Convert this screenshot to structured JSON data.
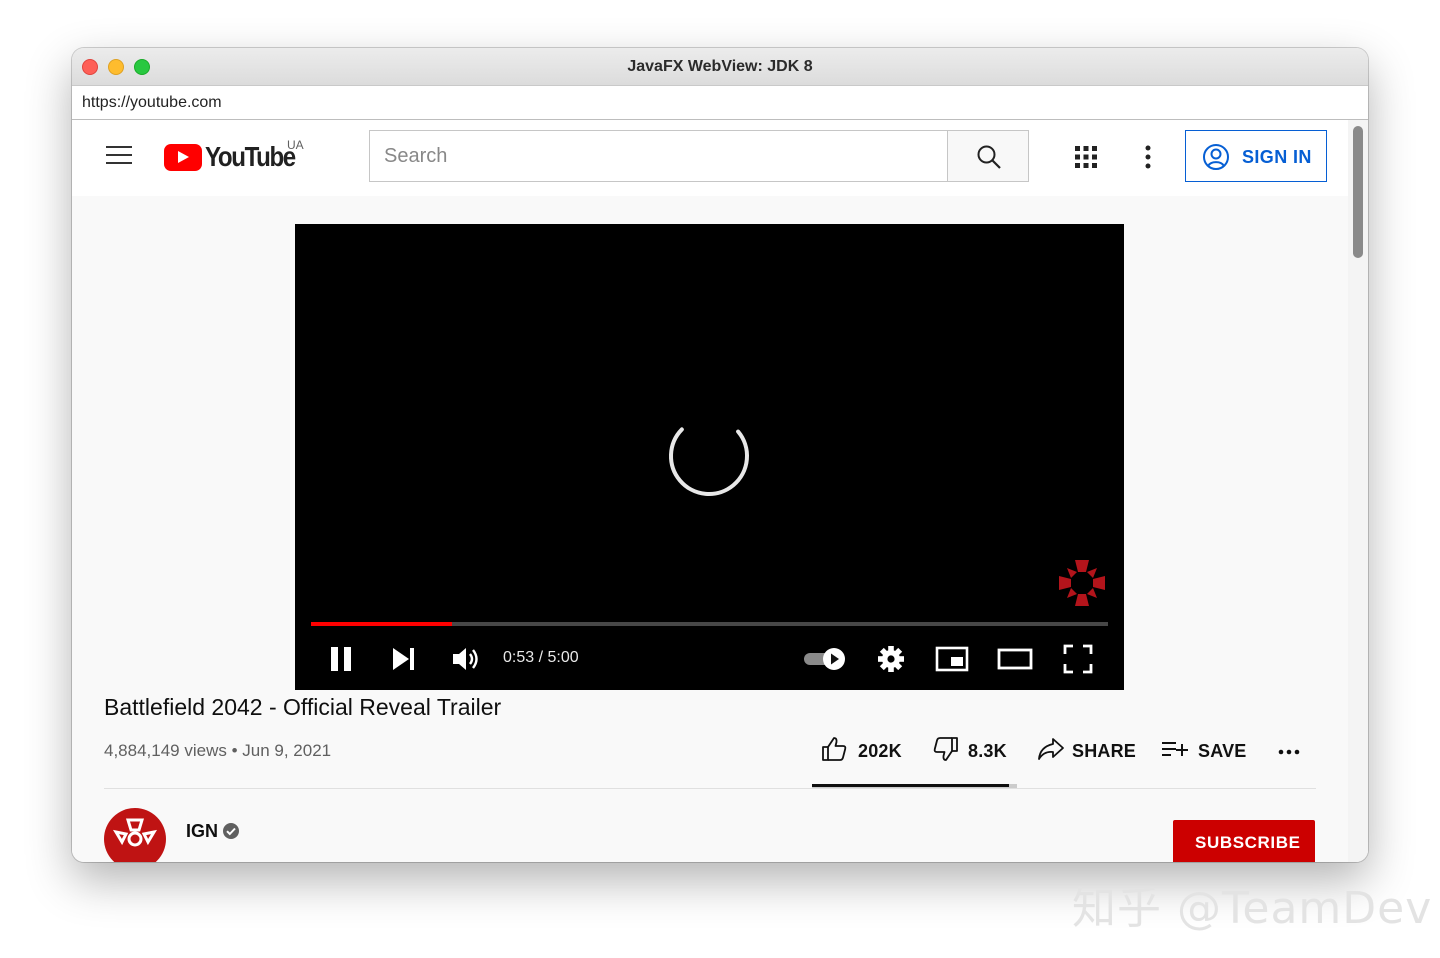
{
  "window": {
    "title": "JavaFX WebView: JDK 8"
  },
  "address_bar": {
    "url": "https://youtube.com"
  },
  "masthead": {
    "logo_text": "YouTube",
    "country_code": "UA",
    "search_placeholder": "Search",
    "sign_in_label": "SIGN IN"
  },
  "player": {
    "current_time": "0:53",
    "duration": "5:00",
    "time_display": "0:53 / 5:00",
    "progress_fraction": 0.177,
    "autoplay": "on",
    "state": "loading"
  },
  "video": {
    "title": "Battlefield 2042 - Official Reveal Trailer",
    "meta": "4,884,149 views • Jun 9, 2021",
    "likes": "202K",
    "dislikes": "8.3K",
    "share_label": "SHARE",
    "save_label": "SAVE",
    "like_ratio": 0.96
  },
  "channel": {
    "name": "IGN",
    "verified": true,
    "subscribe_label": "SUBSCRIBE"
  },
  "site_watermark": "知乎 @TeamDev",
  "colors": {
    "brand_red": "#ff0000",
    "link_blue": "#065fd4",
    "subscribe_red": "#cc0000"
  }
}
